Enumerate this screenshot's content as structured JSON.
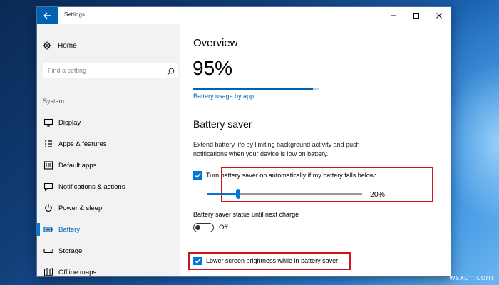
{
  "window": {
    "title": "Settings",
    "controls": {
      "minimize": "—",
      "maximize": "☐",
      "close": "✕"
    }
  },
  "sidebar": {
    "home_label": "Home",
    "search": {
      "placeholder": "Find a setting"
    },
    "section_label": "System",
    "items": [
      {
        "label": "Display",
        "icon": "display-icon"
      },
      {
        "label": "Apps & features",
        "icon": "apps-icon"
      },
      {
        "label": "Default apps",
        "icon": "default-apps-icon"
      },
      {
        "label": "Notifications & actions",
        "icon": "notifications-icon"
      },
      {
        "label": "Power & sleep",
        "icon": "power-icon"
      },
      {
        "label": "Battery",
        "icon": "battery-icon",
        "selected": true
      },
      {
        "label": "Storage",
        "icon": "storage-icon"
      },
      {
        "label": "Offline maps",
        "icon": "map-icon"
      }
    ]
  },
  "main": {
    "overview_heading": "Overview",
    "battery_percent": "95%",
    "battery_level": 0.95,
    "usage_link": "Battery usage by app",
    "saver_heading": "Battery saver",
    "saver_description": "Extend battery life by limiting background activity and push notifications when your device is low on battery.",
    "auto_saver": {
      "checked": true,
      "label": "Turn battery saver on automatically if my battery falls below:",
      "threshold_value": 20,
      "threshold_label": "20%"
    },
    "status_label": "Battery saver status until next charge",
    "status_toggle": {
      "on": false,
      "label": "Off"
    },
    "lower_brightness": {
      "checked": true,
      "label": "Lower screen brightness while in battery saver"
    }
  },
  "colors": {
    "accent": "#0078d7",
    "back_button": "#0063b1",
    "highlight": "#d0141e"
  },
  "watermark": "wsxdn.com"
}
